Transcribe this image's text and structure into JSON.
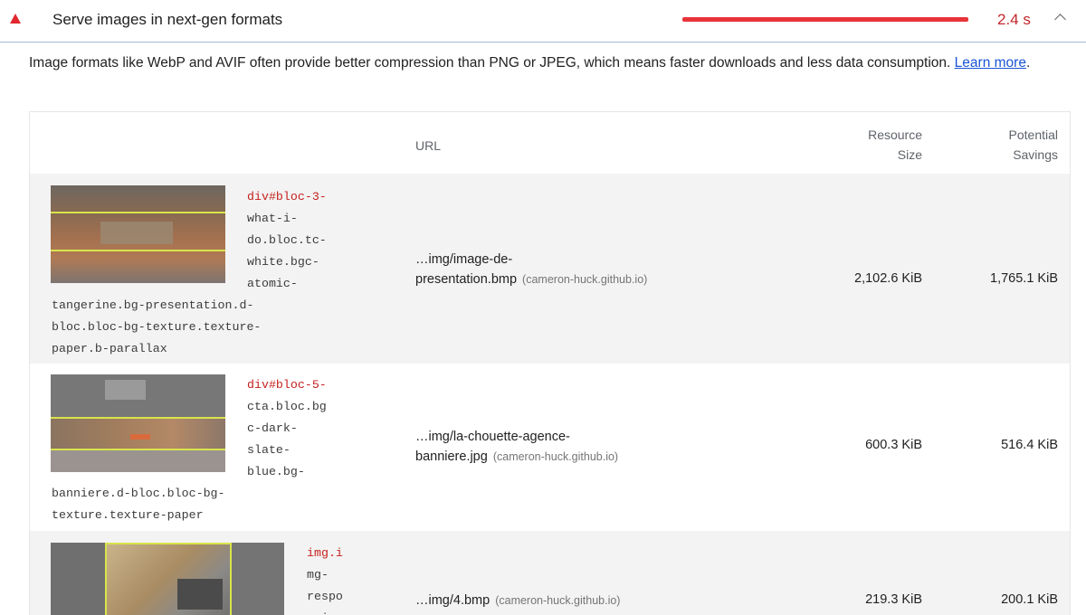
{
  "audit": {
    "title": "Serve images in next-gen formats",
    "savings": "2.4 s",
    "status_color": "#e0282e",
    "description_text": "Image formats like WebP and AVIF often provide better compression than PNG or JPEG, which means faster downloads and less data consumption. ",
    "learn_more": "Learn more",
    "description_end": "."
  },
  "table": {
    "headers": {
      "url": "URL",
      "resource_size_1": "Resource",
      "resource_size_2": "Size",
      "savings_1": "Potential",
      "savings_2": "Savings"
    },
    "rows": [
      {
        "node_lines": [
          "div#bloc-3-",
          "what-i-",
          "do.bloc.tc-",
          "white.bgc-",
          "atomic-",
          "tangerine.bg-presentation.d-",
          "bloc.bloc-bg-texture.texture-",
          "paper.b-parallax"
        ],
        "url_line1": "…img/image-de-",
        "url_line2": "presentation.bmp",
        "host": "(cameron-huck.github.io)",
        "size": "2,102.6 KiB",
        "savings": "1,765.1 KiB"
      },
      {
        "node_lines": [
          "div#bloc-5-",
          "cta.bloc.bg",
          "c-dark-",
          "slate-",
          "blue.bg-",
          "banniere.d-bloc.bloc-bg-",
          "texture.texture-paper"
        ],
        "url_line1": "…img/la-chouette-agence-",
        "url_line2": "banniere.jpg",
        "host": "(cameron-huck.github.io)",
        "size": "600.3 KiB",
        "savings": "516.4 KiB"
      },
      {
        "node_lines": [
          "img.i",
          "mg-",
          "respo",
          "nsive"
        ],
        "url_line1": "…img/4.bmp",
        "host": "(cameron-huck.github.io)",
        "size": "219.3 KiB",
        "savings": "200.1 KiB"
      }
    ]
  }
}
